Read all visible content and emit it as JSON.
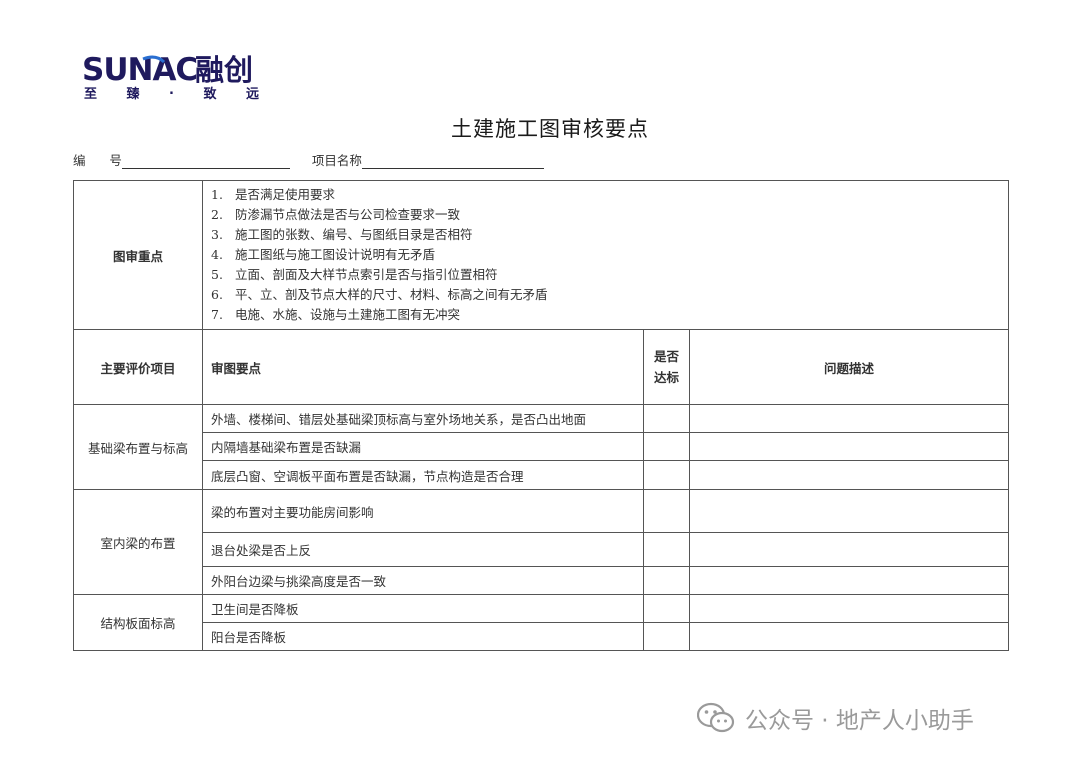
{
  "logo": {
    "brand_en": "SUNAC",
    "brand_cn": "融创",
    "slogan": [
      "至",
      "臻",
      ".",
      "致",
      "远"
    ],
    "colors": {
      "navy": "#1f1a5e",
      "blue": "#2a6fd1"
    }
  },
  "title": "土建施工图审核要点",
  "header": {
    "number_label": "编      号",
    "project_label": "项目名称"
  },
  "table": {
    "focus_label": "图审重点",
    "focus_items": [
      {
        "num": "1.",
        "text": "是否满足使用要求"
      },
      {
        "num": "2.",
        "text": "防渗漏节点做法是否与公司检查要求一致"
      },
      {
        "num": "3.",
        "text": "施工图的张数、编号、与图纸目录是否相符"
      },
      {
        "num": "4.",
        "text": "施工图纸与施工图设计说明有无矛盾"
      },
      {
        "num": "5.",
        "text": "立面、剖面及大样节点索引是否与指引位置相符"
      },
      {
        "num": "6.",
        "text": "平、立、剖及节点大样的尺寸、材料、标高之间有无矛盾"
      },
      {
        "num": "7.",
        "text": "电施、水施、设施与土建施工图有无冲突"
      }
    ],
    "headers": {
      "item": "主要评价项目",
      "points": "审图要点",
      "pass_line1": "是否",
      "pass_line2": "达标",
      "desc": "问题描述"
    },
    "groups": [
      {
        "name": "基础梁布置与标高",
        "rows": [
          "外墙、楼梯间、错层处基础梁顶标高与室外场地关系，是否凸出地面",
          "内隔墙基础梁布置是否缺漏",
          "底层凸窗、空调板平面布置是否缺漏，节点构造是否合理"
        ]
      },
      {
        "name": "室内梁的布置",
        "rows": [
          "梁的布置对主要功能房间影响",
          "退台处梁是否上反",
          "外阳台边梁与挑梁高度是否一致"
        ]
      },
      {
        "name": "结构板面标高",
        "rows": [
          "卫生间是否降板",
          "阳台是否降板"
        ]
      }
    ]
  },
  "watermark": {
    "text": "公众号 · 地产人小助手",
    "icon": "wechat-icon"
  }
}
